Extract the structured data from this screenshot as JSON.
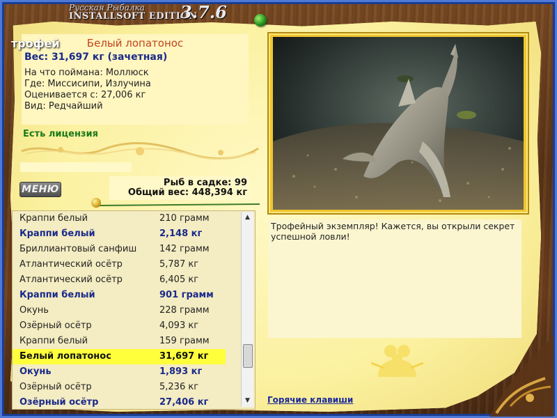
{
  "app": {
    "title_ru": "Русская Рыбалка",
    "title_main": "INSTALLSOFT EDITION",
    "version": "3.7.6"
  },
  "catch": {
    "name": "Белый лопатонос",
    "weight_line": "Вес: 31,697 кг (зачетная)",
    "caught_on": "На что поймана: Моллюск",
    "where": "Где: Миссисипи, Излучина",
    "valued_from": "Оценивается с: 27,006 кг",
    "kind": "Вид: Редчайший"
  },
  "license": "Есть лицензия",
  "menu_button": "МЕНЮ",
  "totals": {
    "fish_count": "Рыб в садке: 99",
    "total_weight": "Общий вес: 448,394 кг"
  },
  "fish_list": [
    {
      "name": "Краппи белый",
      "weight": "210 грамм",
      "style": "normal"
    },
    {
      "name": "Краппи белый",
      "weight": "2,148 кг",
      "style": "bold"
    },
    {
      "name": "Бриллиантовый санфиш",
      "weight": "142 грамм",
      "style": "normal"
    },
    {
      "name": "Атлантический осётр",
      "weight": "5,787 кг",
      "style": "normal"
    },
    {
      "name": "Атлантический осётр",
      "weight": "6,405 кг",
      "style": "normal"
    },
    {
      "name": "Краппи белый",
      "weight": "901 грамм",
      "style": "bold"
    },
    {
      "name": "Окунь",
      "weight": "228 грамм",
      "style": "normal"
    },
    {
      "name": "Озёрный осётр",
      "weight": "4,093 кг",
      "style": "normal"
    },
    {
      "name": "Краппи белый",
      "weight": "159 грамм",
      "style": "normal"
    },
    {
      "name": "Белый лопатонос",
      "weight": "31,697 кг",
      "style": "selected"
    },
    {
      "name": "Окунь",
      "weight": "1,893 кг",
      "style": "bold"
    },
    {
      "name": "Озёрный осётр",
      "weight": "5,236 кг",
      "style": "normal"
    },
    {
      "name": "Озёрный осётр",
      "weight": "27,406 кг",
      "style": "bold"
    }
  ],
  "photo_label": "трофей",
  "description": "Трофейный экземпляр! Кажется, вы открыли секрет успешной ловли!",
  "hotkeys_link": "Горячие клавиши",
  "colors": {
    "paper": "#fbf2a4",
    "name_accent": "#c0441c",
    "bold_text": "#1a2a8a",
    "selection": "#ffff3c",
    "license": "#1a7a1a",
    "frame_blue": "#1b3d93"
  }
}
